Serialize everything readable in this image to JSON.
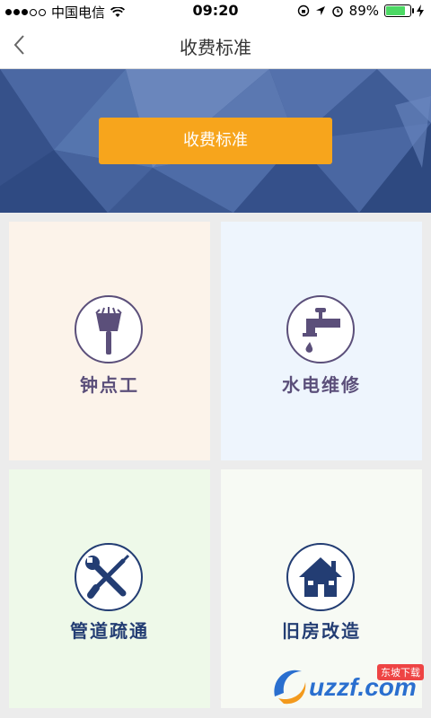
{
  "status_bar": {
    "carrier": "中国电信",
    "time": "09:20",
    "battery": "89%",
    "battery_level": 0.89
  },
  "nav": {
    "title": "收费标准"
  },
  "banner": {
    "button_label": "收费标准",
    "button_color": "#f7a51c"
  },
  "services": [
    {
      "label": "钟点工",
      "icon": "broom-icon"
    },
    {
      "label": "水电维修",
      "icon": "faucet-icon"
    },
    {
      "label": "管道疏通",
      "icon": "tools-icon"
    },
    {
      "label": "旧房改造",
      "icon": "house-icon"
    }
  ],
  "watermark": {
    "text": "uzzf.com",
    "tag": "东坡下载"
  }
}
